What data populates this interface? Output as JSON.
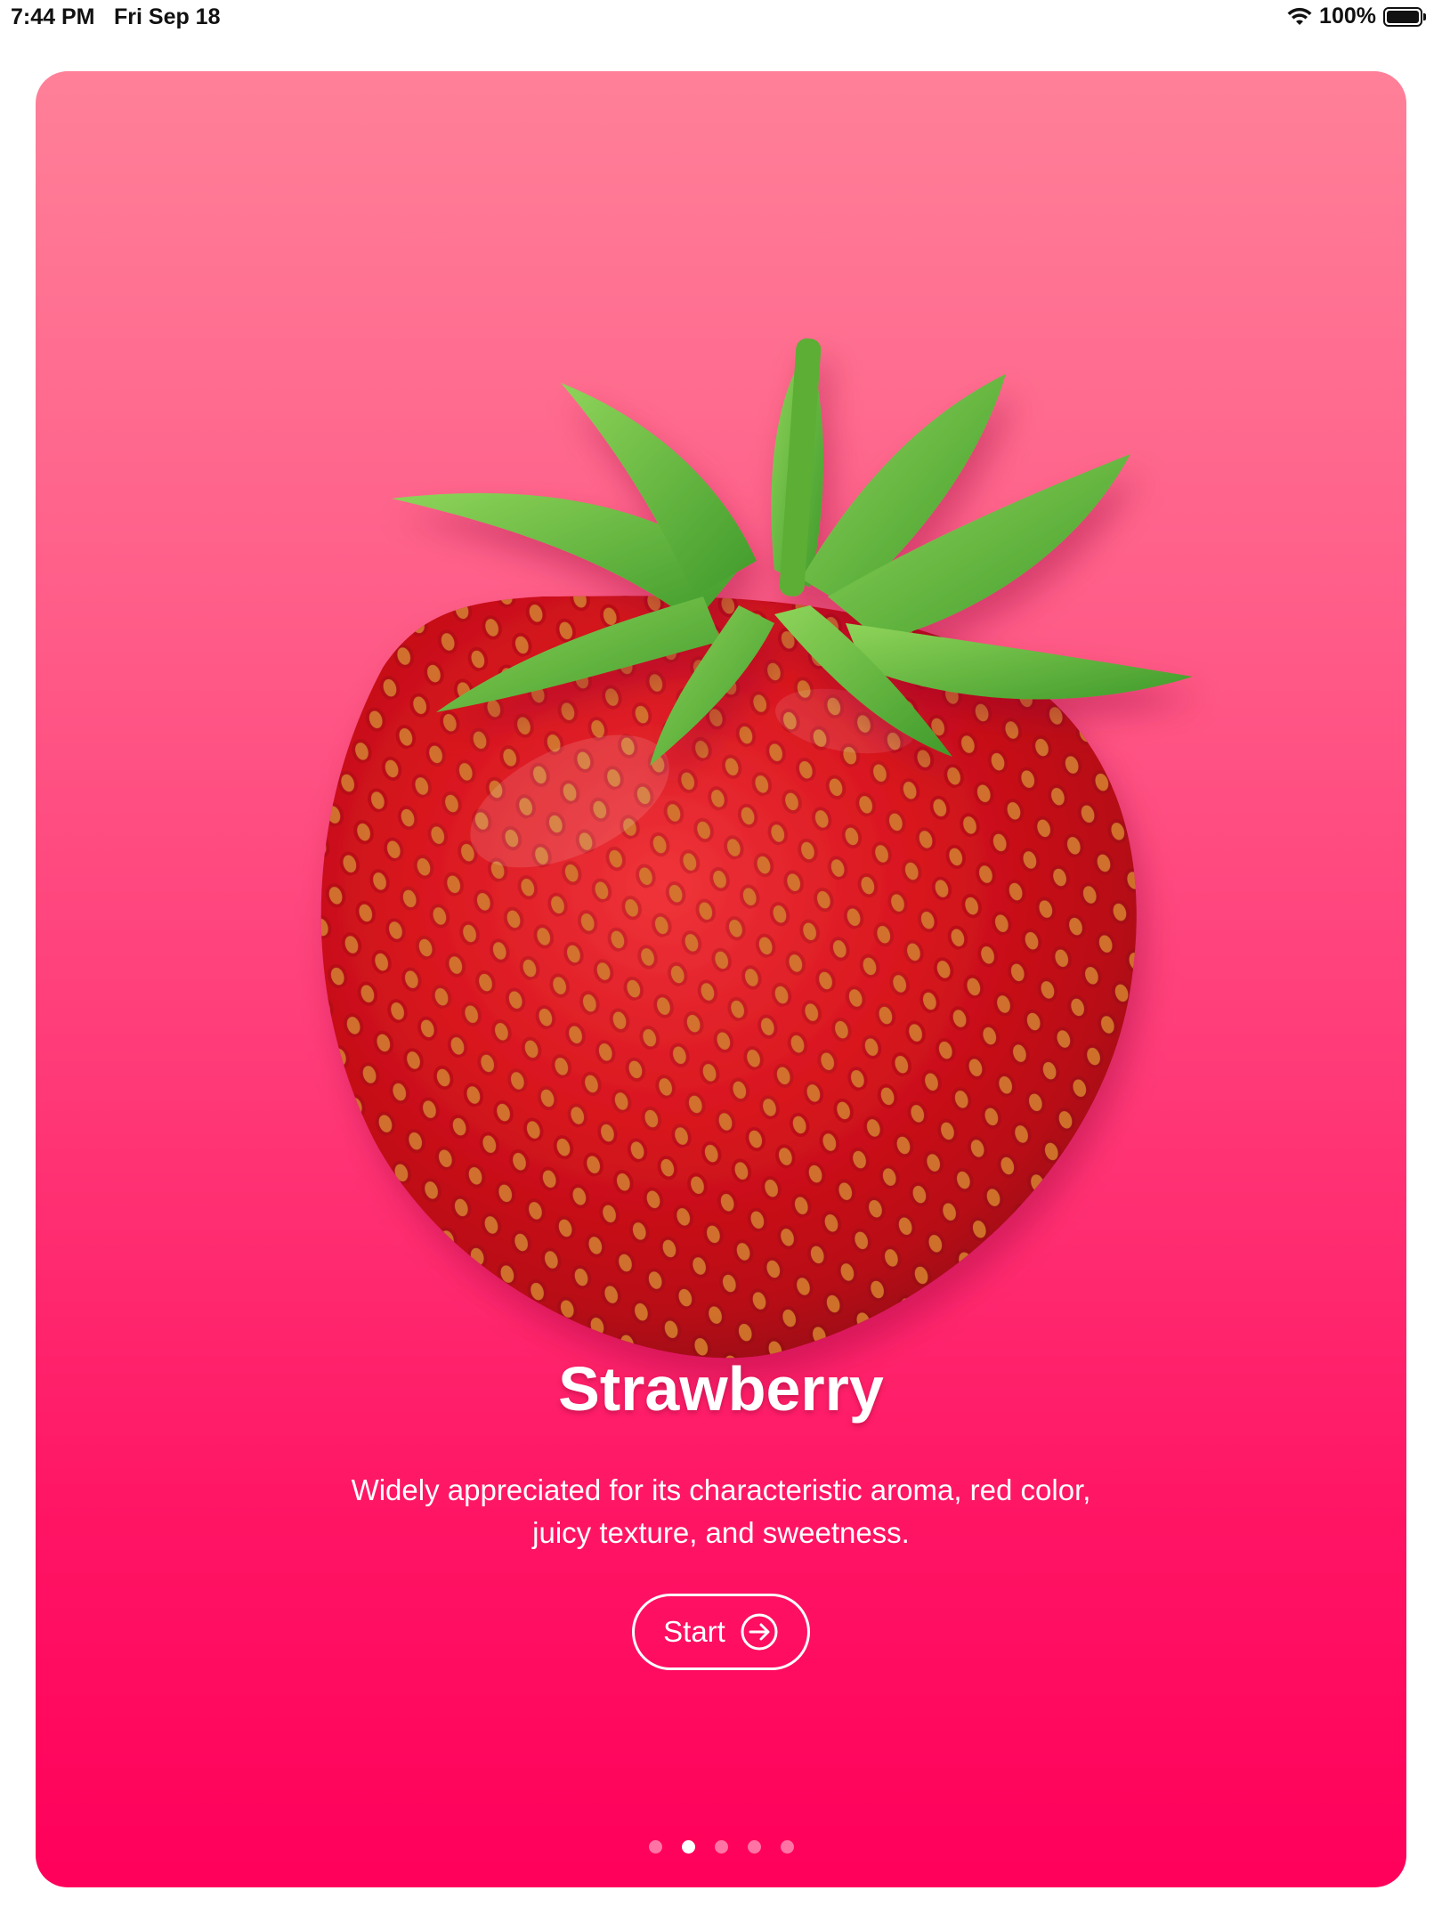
{
  "status_bar": {
    "time": "7:44 PM",
    "date": "Fri Sep 18",
    "battery_percent": "100%",
    "battery_level": 1.0,
    "icons": [
      "wifi-icon",
      "battery-icon"
    ]
  },
  "onboarding": {
    "title": "Strawberry",
    "description_line1": "Widely appreciated for its characteristic aroma,  red color,",
    "description_line2": "juicy texture, and sweetness.",
    "start_label": "Start",
    "start_icon": "arrow-right-circle-icon",
    "hero_image": "strawberry-image",
    "page_count": 5,
    "current_page": 2
  },
  "colors": {
    "gradient_top": "#ff8098",
    "gradient_bottom": "#ff005a",
    "text": "#ffffff"
  }
}
